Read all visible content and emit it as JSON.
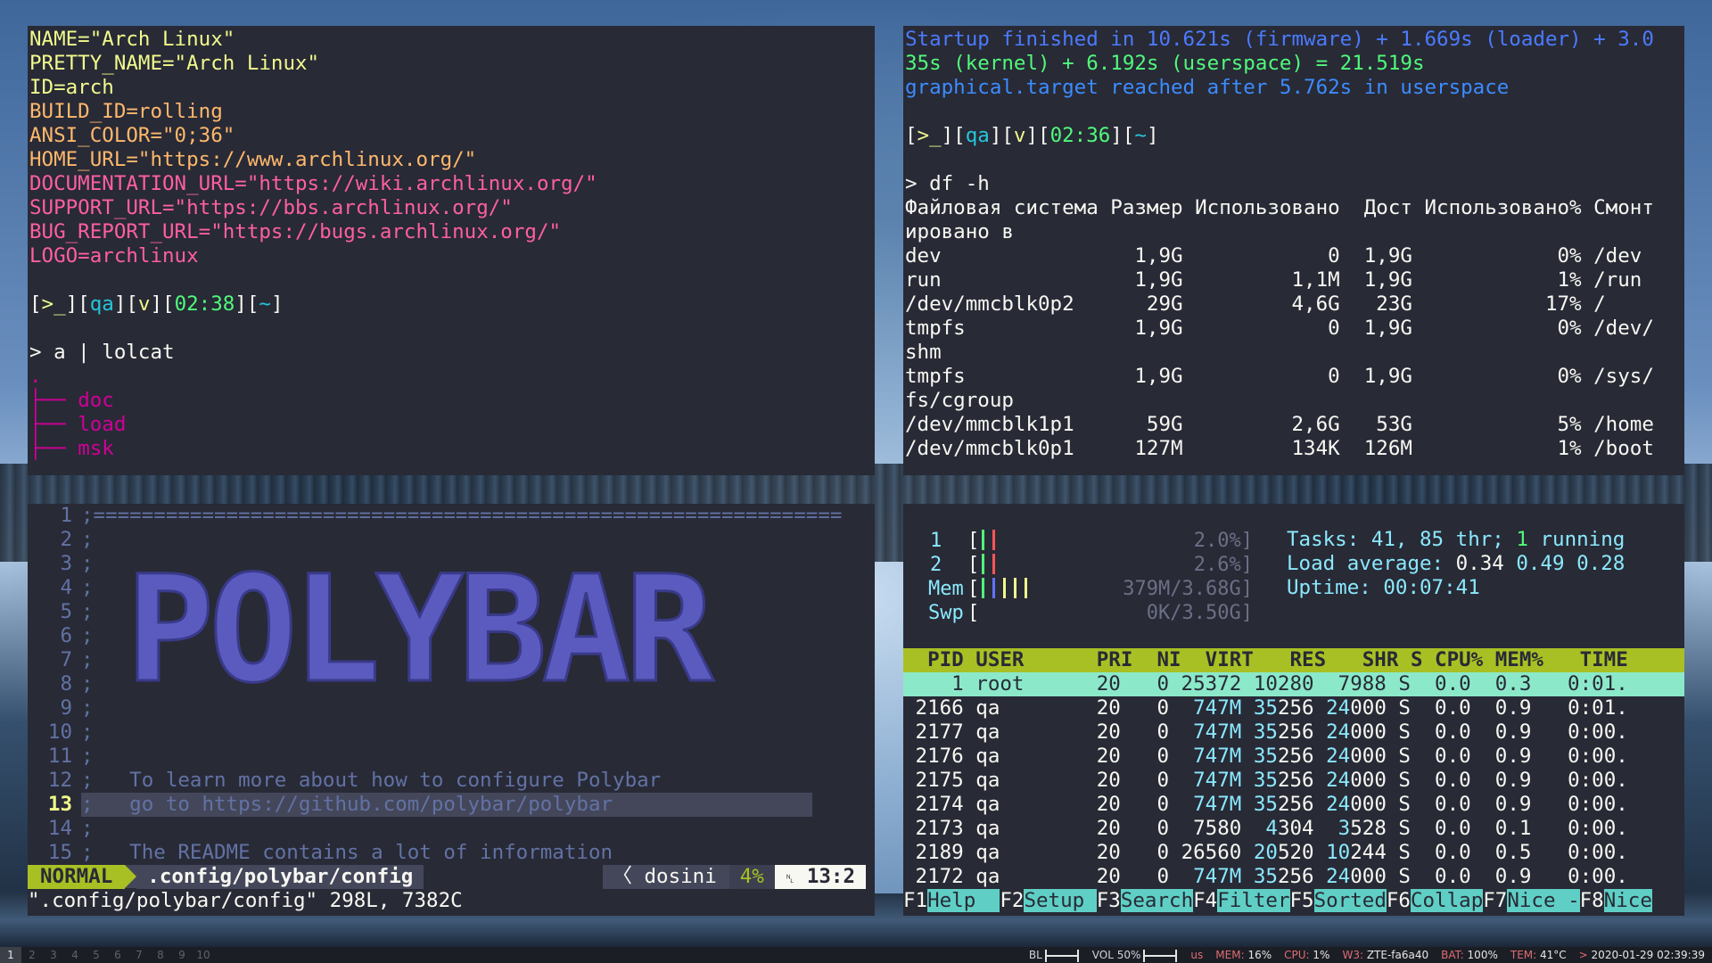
{
  "term1": {
    "lines": [
      {
        "text": "NAME=\"Arch Linux\"",
        "cls": "y"
      },
      {
        "text": "PRETTY_NAME=\"Arch Linux\"",
        "cls": "y"
      },
      {
        "text": "ID=arch",
        "cls": "y"
      },
      {
        "text": "BUILD_ID=rolling",
        "cls": "o"
      },
      {
        "text": "ANSI_COLOR=\"0;36\"",
        "cls": "o"
      },
      {
        "text": "HOME_URL=\"https://www.archlinux.org/\"",
        "cls": "o"
      },
      {
        "text": "DOCUMENTATION_URL=\"https://wiki.archlinux.org/\"",
        "cls": "pk"
      },
      {
        "text": "SUPPORT_URL=\"https://bbs.archlinux.org/\"",
        "cls": "pk"
      },
      {
        "text": "BUG_REPORT_URL=\"https://bugs.archlinux.org/\"",
        "cls": "pk"
      },
      {
        "text": "LOGO=archlinux",
        "cls": "pk"
      }
    ],
    "prompt": {
      "p1": "[",
      "p2": ">_",
      "p3": "][",
      "p4": "qa",
      "p5": "][",
      "p6": "v",
      "p7": "][",
      "p8": "02:38",
      "p9": "][",
      "p10": "~",
      "p11": "]"
    },
    "command": "> a | lolcat",
    "tree_root": ".",
    "tree_items": [
      "doc",
      "load",
      "msk"
    ]
  },
  "term2": {
    "boot_lines": [
      "Startup finished in 10.621s (firmware) + 1.669s (loader) + 3.0",
      "35s (kernel) + 6.192s (userspace) = 21.519s",
      "graphical.target reached after 5.762s in userspace"
    ],
    "prompt": {
      "p1": "[",
      "p2": ">_",
      "p3": "][",
      "p4": "qa",
      "p5": "][",
      "p6": "v",
      "p7": "][",
      "p8": "02:36",
      "p9": "][",
      "p10": "~",
      "p11": "]"
    },
    "command": "> df -h",
    "df_lines": [
      "Файловая система Размер Использовано  Дост Использовано% Смонт",
      "ировано в",
      "dev                1,9G            0  1,9G            0% /dev",
      "run                1,9G         1,1M  1,9G            1% /run",
      "/dev/mmcblk0p2      29G         4,6G   23G           17% /",
      "tmpfs              1,9G            0  1,9G            0% /dev/",
      "shm",
      "tmpfs              1,9G            0  1,9G            0% /sys/",
      "fs/cgroup",
      "/dev/mmcblk1p1      59G         2,6G   53G            5% /home",
      "/dev/mmcblk0p1     127M         134K  126M            1% /boot"
    ]
  },
  "vim": {
    "line_numbers": [
      "1",
      "2",
      "3",
      "4",
      "5",
      "6",
      "7",
      "8",
      "9",
      "10",
      "11",
      "12",
      "13",
      "14",
      "15"
    ],
    "line1": ";==============================================================",
    "line12": ";   To learn more about how to configure Polybar",
    "line13": ";   go to https://github.com/polybar/polybar",
    "line15": ";   The README contains a lot of information",
    "art_text": "POLYBAR",
    "mode": "NORMAL",
    "file": ".config/polybar/config",
    "filetype": "〈 dosini",
    "percent": "4%",
    "position": "13:2",
    "position_icon": "␤",
    "cmdline": "\".config/polybar/config\" 298L, 7382C"
  },
  "htop": {
    "cpu1_label": "1",
    "cpu1_val": "2.0%]",
    "cpu2_label": "2",
    "cpu2_val": "2.6%]",
    "mem_label": "Mem",
    "mem_val": "379M/3.68G]",
    "swp_label": "Swp",
    "swp_val": "0K/3.50G]",
    "cpu1_fraction": 0.02,
    "cpu2_fraction": 0.026,
    "mem_fraction": 0.1,
    "swap_fraction": 0.0,
    "tasks_label": "Tasks: ",
    "tasks_val": "41, 85 thr; ",
    "running_val": "1",
    "running_label": " running",
    "load_label": "Load average: ",
    "load1": "0.34",
    "load5": "0.49",
    "load15": "0.28",
    "uptime_label": "Uptime: ",
    "uptime_val": "00:07:41",
    "header": "  PID USER      PRI  NI  VIRT   RES   SHR S CPU% MEM%   TIME",
    "rows": [
      {
        "pid": "1",
        "user": "root",
        "pri": "20",
        "ni": "0",
        "virt": "25372",
        "res": "10280",
        "shr": "7988",
        "s": "S",
        "cpu": "0.0",
        "mem": "0.3",
        "time": "0:01."
      },
      {
        "pid": "2166",
        "user": "qa",
        "pri": "20",
        "ni": "0",
        "virt": "747M",
        "res": "35256",
        "shr": "24000",
        "s": "S",
        "cpu": "0.0",
        "mem": "0.9",
        "time": "0:01."
      },
      {
        "pid": "2177",
        "user": "qa",
        "pri": "20",
        "ni": "0",
        "virt": "747M",
        "res": "35256",
        "shr": "24000",
        "s": "S",
        "cpu": "0.0",
        "mem": "0.9",
        "time": "0:00."
      },
      {
        "pid": "2176",
        "user": "qa",
        "pri": "20",
        "ni": "0",
        "virt": "747M",
        "res": "35256",
        "shr": "24000",
        "s": "S",
        "cpu": "0.0",
        "mem": "0.9",
        "time": "0:00."
      },
      {
        "pid": "2175",
        "user": "qa",
        "pri": "20",
        "ni": "0",
        "virt": "747M",
        "res": "35256",
        "shr": "24000",
        "s": "S",
        "cpu": "0.0",
        "mem": "0.9",
        "time": "0:00."
      },
      {
        "pid": "2174",
        "user": "qa",
        "pri": "20",
        "ni": "0",
        "virt": "747M",
        "res": "35256",
        "shr": "24000",
        "s": "S",
        "cpu": "0.0",
        "mem": "0.9",
        "time": "0:00."
      },
      {
        "pid": "2173",
        "user": "qa",
        "pri": "20",
        "ni": "0",
        "virt": "7580",
        "res": "4304",
        "shr": "3528",
        "s": "S",
        "cpu": "0.0",
        "mem": "0.1",
        "time": "0:00."
      },
      {
        "pid": "2189",
        "user": "qa",
        "pri": "20",
        "ni": "0",
        "virt": "26560",
        "res": "20520",
        "shr": "10244",
        "s": "S",
        "cpu": "0.0",
        "mem": "0.5",
        "time": "0:00."
      },
      {
        "pid": "2172",
        "user": "qa",
        "pri": "20",
        "ni": "0",
        "virt": "747M",
        "res": "35256",
        "shr": "24000",
        "s": "S",
        "cpu": "0.0",
        "mem": "0.9",
        "time": "0:00."
      }
    ],
    "fkeys": [
      {
        "key": "F1",
        "label": "Help  "
      },
      {
        "key": "F2",
        "label": "Setup "
      },
      {
        "key": "F3",
        "label": "Search"
      },
      {
        "key": "F4",
        "label": "Filter"
      },
      {
        "key": "F5",
        "label": "Sorted"
      },
      {
        "key": "F6",
        "label": "Collap"
      },
      {
        "key": "F7",
        "label": "Nice -"
      },
      {
        "key": "F8",
        "label": "Nice"
      }
    ]
  },
  "bar": {
    "workspaces": [
      "1",
      "2",
      "3",
      "4",
      "5",
      "6",
      "7",
      "8",
      "9",
      "10"
    ],
    "active_workspace": "1",
    "backlight_label": "BL",
    "volume_label": "VOL 50%",
    "keyboard": "us",
    "mem_label": "MEM:",
    "mem_val": "16%",
    "cpu_label": "CPU:",
    "cpu_val": "1%",
    "wifi_label": "W3:",
    "wifi_val": "ZTE-fa6a40",
    "bat_label": "BAT:",
    "bat_val": "100%",
    "temp_label": "TEM:",
    "temp_val": "41°C",
    "date_arrow": ">",
    "datetime": "2020-01-29 02:39:39",
    "backlight_fraction": 0.5,
    "volume_fraction": 0.5
  },
  "colors": {
    "terminal_bg": "#282a36",
    "vim_mode": "#a8c023",
    "htop_header": "#a8c023",
    "htop_selected": "#8be9c9",
    "polybar_art": "#5b5bbf"
  }
}
